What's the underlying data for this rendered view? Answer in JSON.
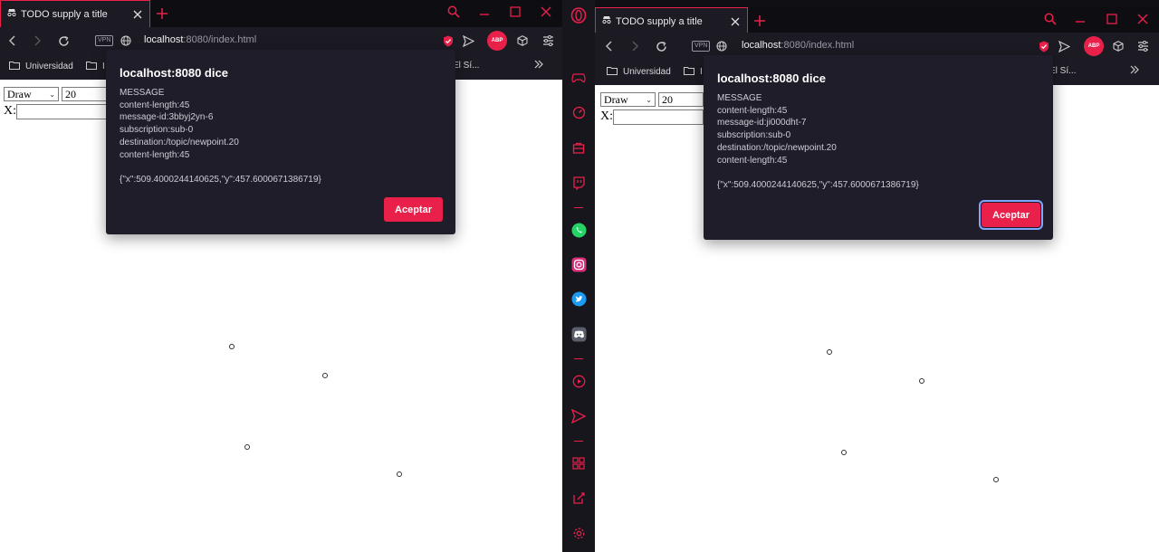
{
  "left_window": {
    "tab_title": "TODO supply a title",
    "url_host": "localhost",
    "url_rest": ":8080/index.html",
    "bookmarks": [
      {
        "label": "Universidad"
      },
      {
        "label": "I"
      },
      {
        "label": "El Sí..."
      }
    ],
    "page": {
      "select_value": "Draw",
      "number_value": "20",
      "x_label": "X:"
    },
    "dialog": {
      "title": "localhost:8080 dice",
      "lines": [
        "MESSAGE",
        "content-length:45",
        "message-id:3bbyj2yn-6",
        "subscription:sub-0",
        "destination:/topic/newpoint.20",
        "content-length:45"
      ],
      "payload": "{\"x\":509.4000244140625,\"y\":457.6000671386719}",
      "button": "Aceptar"
    }
  },
  "right_window": {
    "tab_title": "TODO supply a title",
    "url_host": "localhost",
    "url_rest": ":8080/index.html",
    "bookmarks": [
      {
        "label": "Universidad"
      },
      {
        "label": "I"
      },
      {
        "label": "El Sí..."
      }
    ],
    "page": {
      "select_value": "Draw",
      "number_value": "20",
      "x_label": "X:"
    },
    "dialog": {
      "title": "localhost:8080 dice",
      "lines": [
        "MESSAGE",
        "content-length:45",
        "message-id:ji000dht-7",
        "subscription:sub-0",
        "destination:/topic/newpoint.20",
        "content-length:45"
      ],
      "payload": "{\"x\":509.4000244140625,\"y\":457.6000671386719}",
      "button": "Aceptar"
    },
    "sidebar_icons": [
      "opera-logo-icon",
      "gamepad-icon",
      "speedometer-icon",
      "shopping-bag-icon",
      "twitch-icon",
      "whatsapp-icon",
      "instagram-icon",
      "twitter-icon",
      "discord-icon",
      "player-icon",
      "send-icon",
      "extensions-icon",
      "edit-icon",
      "gear-icon"
    ]
  },
  "colors": {
    "accent": "#e8204a",
    "chrome": "#1c1b24",
    "dialog": "#1f1d29"
  }
}
